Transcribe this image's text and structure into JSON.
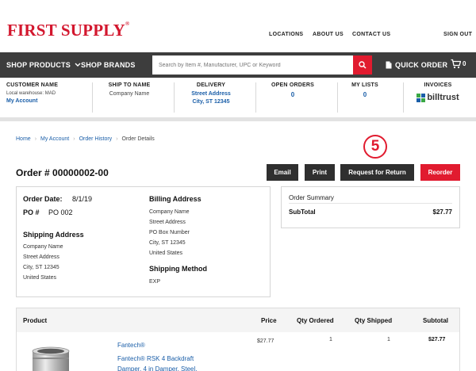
{
  "brand": {
    "logo_text": "FIRST SUPPLY",
    "logo_mark": "®",
    "accent": "#e11b2f",
    "nav_bg": "#3d3d3d",
    "link_color": "#1a5ea8"
  },
  "top_links": [
    "LOCATIONS",
    "ABOUT US",
    "CONTACT US",
    "SIGN OUT"
  ],
  "nav": {
    "shop_products": "SHOP PRODUCTS",
    "shop_brands": "SHOP BRANDS",
    "search_placeholder": "Search by Item #, Manufacturer, UPC or Keyword",
    "quick_order": "QUICK ORDER",
    "icons": [
      "chevron-down-icon",
      "search-icon",
      "document-icon",
      "cart-icon"
    ],
    "cart_count": "0"
  },
  "account_bar": {
    "customer_name": {
      "label": "CUSTOMER NAME",
      "sub": "Local warehouse: MAD",
      "link": "My Account"
    },
    "ship_to": {
      "label": "SHIP TO NAME",
      "value": "Company Name"
    },
    "delivery": {
      "label": "DELIVERY",
      "line1": "Street Address",
      "line2": "City, ST 12345"
    },
    "open_orders": {
      "label": "OPEN ORDERS",
      "value": "0"
    },
    "my_lists": {
      "label": "MY LISTS",
      "value": "0"
    },
    "invoices": {
      "label": "INVOICES",
      "logo": "billtrust"
    }
  },
  "breadcrumb": [
    "Home",
    "My Account",
    "Order History",
    "Order Details"
  ],
  "order": {
    "title": "Order # 00000002-00",
    "buttons": {
      "email": "Email",
      "print": "Print",
      "return": "Request for Return",
      "reorder": "Reorder"
    },
    "step_marker": "5",
    "date_label": "Order Date:",
    "date_value": "8/1/19",
    "po_label": "PO #",
    "po_value": "PO 002",
    "shipping_address": {
      "title": "Shipping Address",
      "lines": [
        "Company Name",
        "Street Address",
        "City, ST 12345",
        "United States"
      ]
    },
    "billing_address": {
      "title": "Billing Address",
      "lines": [
        "Company Name",
        "Street Address",
        "PO Box Number",
        "City, ST 12345",
        "United States"
      ]
    },
    "shipping_method": {
      "title": "Shipping Method",
      "value": "EXP"
    }
  },
  "summary": {
    "title": "Order Summary",
    "subtotal_label": "SubTotal",
    "subtotal_value": "$27.77"
  },
  "products": {
    "headers": {
      "product": "Product",
      "price": "Price",
      "qty_ordered": "Qty Ordered",
      "qty_shipped": "Qty Shipped",
      "subtotal": "Subtotal"
    },
    "rows": [
      {
        "brand": "Fantech®",
        "name_line1": "Fantech® RSK 4 Backdraft",
        "name_line2": "Damper, 4 in Damper, Steel,",
        "price": "$27.77",
        "qty_ordered": "1",
        "qty_shipped": "1",
        "subtotal": "$27.77"
      }
    ]
  }
}
